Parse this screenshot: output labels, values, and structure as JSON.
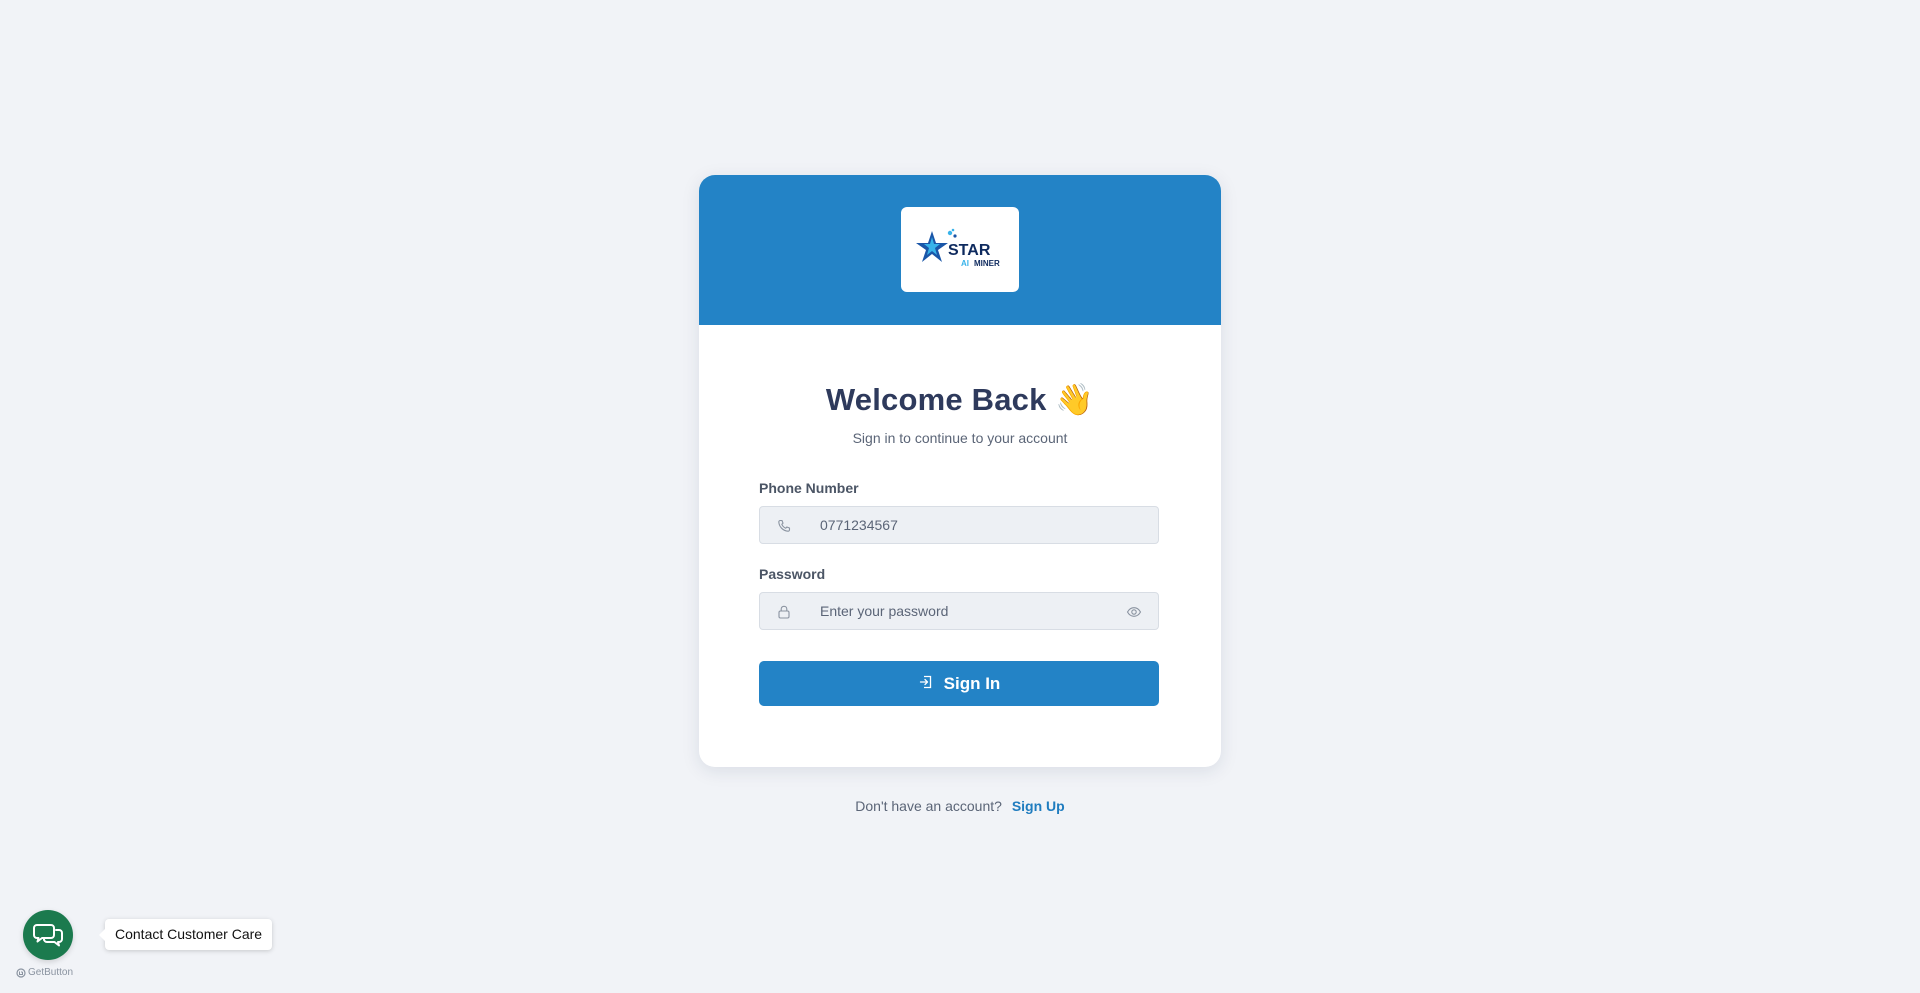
{
  "logo": {
    "alt": "Star AI Miner logo",
    "word_main": "STAR",
    "word_sub_prefix": "AI",
    "word_sub": "MINER"
  },
  "login": {
    "title": "Welcome Back 👋",
    "subtitle": "Sign in to continue to your account",
    "phone": {
      "label": "Phone Number",
      "value": "0771234567",
      "icon": "phone-icon"
    },
    "password": {
      "label": "Password",
      "placeholder": "Enter your password",
      "icon": "lock-icon",
      "toggle_icon": "eye-icon"
    },
    "submit": {
      "label": "Sign In",
      "icon": "sign-in-icon"
    }
  },
  "footer": {
    "prompt": "Don't have an account?",
    "signup_label": "Sign Up"
  },
  "chat_widget": {
    "tooltip": "Contact Customer Care",
    "icon": "chat-bubbles-icon",
    "brand": "GetButton"
  },
  "colors": {
    "primary": "#2383c6",
    "background": "#f1f3f7",
    "title": "#2e3a5c",
    "chat_green": "#1b7a4e"
  }
}
